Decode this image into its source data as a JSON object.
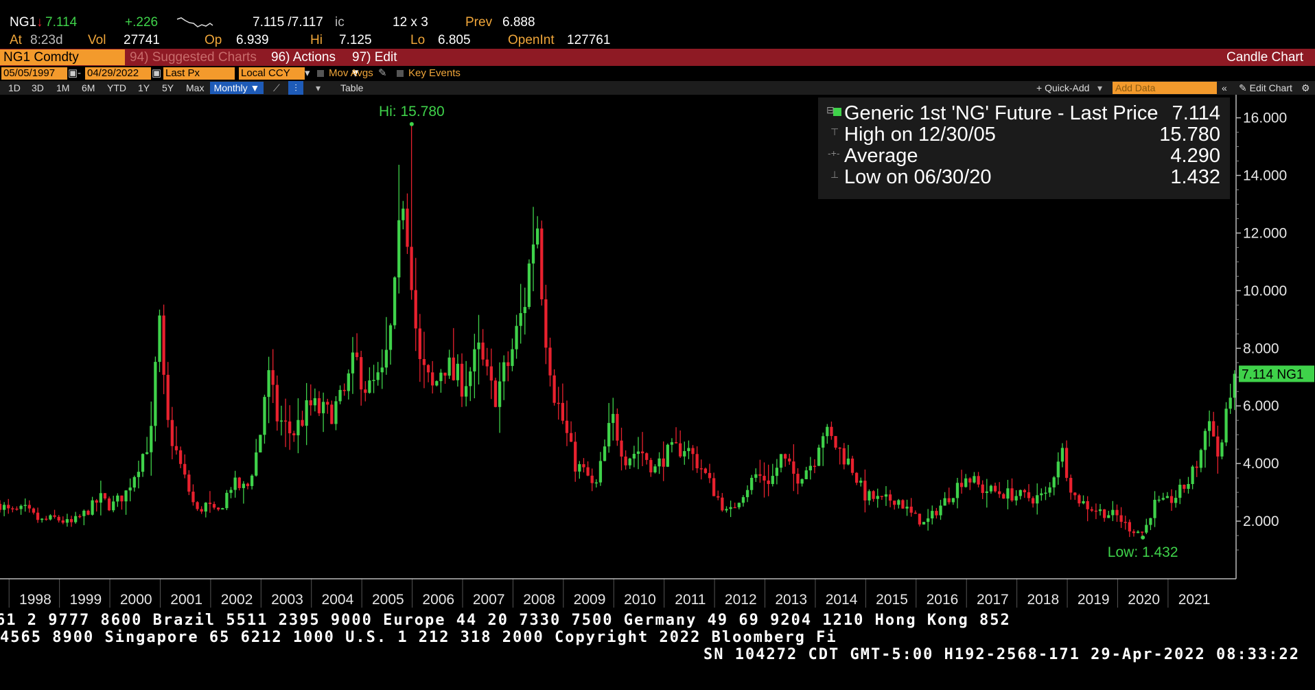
{
  "ticker": {
    "symbol": "NG1",
    "arrow": "↓",
    "last": "7.114",
    "change": "+.226",
    "bidask": "7.115 /7.117",
    "bidask_suffix": "ic",
    "size": "12 x 3",
    "prev_label": "Prev",
    "prev": "6.888",
    "at_label": "At",
    "time": "8:23d",
    "vol_label": "Vol",
    "vol": "27741",
    "op_label": "Op",
    "op": "6.939",
    "hi_label": "Hi",
    "hi": "7.125",
    "lo_label": "Lo",
    "lo": "6.805",
    "oi_label": "OpenInt",
    "oi": "127761"
  },
  "menubar": {
    "security": "NG1 Comdty",
    "suggested": "94) Suggested Charts",
    "actions": "96) Actions",
    "edit": "97) Edit",
    "chart_type": "Candle Chart"
  },
  "settings": {
    "start_date": "05/05/1997",
    "end_date": "04/29/2022",
    "field": "Last Px",
    "currency": "Local CCY",
    "mov_avgs": "Mov Avgs",
    "key_events": "Key Events"
  },
  "periods": {
    "items": [
      "1D",
      "3D",
      "1M",
      "6M",
      "YTD",
      "1Y",
      "5Y",
      "Max"
    ],
    "selected": "Monthly",
    "table": "Table",
    "quick_add": "+ Quick-Add",
    "add_data": "Add Data",
    "edit_chart": "Edit Chart"
  },
  "legend": {
    "title": "Generic 1st 'NG' Future - Last Price",
    "last": "7.114",
    "high_label": "High on 12/30/05",
    "high": "15.780",
    "avg_label": "Average",
    "avg": "4.290",
    "low_label": "Low on 06/30/20",
    "low": "1.432"
  },
  "footer": {
    "line1": "61 2 9777 8600 Brazil 5511 2395 9000 Europe 44 20 7330 7500 Germany 49 69 9204 1210 Hong Kong 852",
    "line2": " 4565 8900        Singapore 65 6212 1000        U.S. 1 212 318 2000        Copyright 2022 Bloomberg Fi",
    "line3": "SN 104272 CDT  GMT-5:00 H192-2568-171 29-Apr-2022 08:33:22"
  },
  "colors": {
    "up": "#3fd24a",
    "down": "#e8212e",
    "accent": "#f39a2c",
    "menubar": "#8e1a24"
  },
  "chart_data": {
    "type": "candlestick",
    "interval": "monthly",
    "y_axis_side": "right",
    "ylim": [
      0,
      16.8
    ],
    "y_ticks": [
      "2.000",
      "4.000",
      "6.000",
      "8.000",
      "10.000",
      "12.000",
      "14.000",
      "16.000"
    ],
    "x_labels": [
      "1998",
      "1999",
      "2000",
      "2001",
      "2002",
      "2003",
      "2004",
      "2005",
      "2006",
      "2007",
      "2008",
      "2009",
      "2010",
      "2011",
      "2012",
      "2013",
      "2014",
      "2015",
      "2016",
      "2017",
      "2018",
      "2019",
      "2020",
      "2021"
    ],
    "x_start": 1997.8,
    "x_end": 2022.33,
    "close_points": [
      [
        1997.8,
        2.6
      ],
      [
        1998.0,
        2.3
      ],
      [
        1998.3,
        2.4
      ],
      [
        1998.6,
        2.0
      ],
      [
        1998.9,
        2.1
      ],
      [
        1999.2,
        1.9
      ],
      [
        1999.5,
        2.3
      ],
      [
        1999.8,
        2.8
      ],
      [
        2000.0,
        2.5
      ],
      [
        2000.3,
        3.0
      ],
      [
        2000.6,
        4.2
      ],
      [
        2000.8,
        5.0
      ],
      [
        2000.95,
        9.0
      ],
      [
        2001.1,
        5.5
      ],
      [
        2001.4,
        3.8
      ],
      [
        2001.7,
        2.3
      ],
      [
        2001.9,
        2.6
      ],
      [
        2002.1,
        2.2
      ],
      [
        2002.4,
        3.3
      ],
      [
        2002.7,
        3.1
      ],
      [
        2002.95,
        4.8
      ],
      [
        2003.1,
        7.2
      ],
      [
        2003.3,
        5.6
      ],
      [
        2003.6,
        5.0
      ],
      [
        2003.95,
        6.0
      ],
      [
        2004.3,
        5.7
      ],
      [
        2004.6,
        6.2
      ],
      [
        2004.85,
        7.6
      ],
      [
        2005.1,
        6.5
      ],
      [
        2005.4,
        7.0
      ],
      [
        2005.6,
        9.0
      ],
      [
        2005.8,
        13.5
      ],
      [
        2005.95,
        11.2
      ],
      [
        2006.1,
        7.5
      ],
      [
        2006.4,
        6.5
      ],
      [
        2006.6,
        7.6
      ],
      [
        2006.8,
        7.0
      ],
      [
        2007.0,
        6.8
      ],
      [
        2007.3,
        7.8
      ],
      [
        2007.6,
        6.3
      ],
      [
        2007.9,
        7.5
      ],
      [
        2008.2,
        9.5
      ],
      [
        2008.45,
        12.8
      ],
      [
        2008.6,
        9.0
      ],
      [
        2008.8,
        6.5
      ],
      [
        2008.95,
        5.6
      ],
      [
        2009.2,
        4.0
      ],
      [
        2009.45,
        3.6
      ],
      [
        2009.6,
        3.0
      ],
      [
        2009.8,
        4.5
      ],
      [
        2009.95,
        5.6
      ],
      [
        2010.2,
        4.2
      ],
      [
        2010.5,
        4.5
      ],
      [
        2010.8,
        3.8
      ],
      [
        2011.0,
        4.3
      ],
      [
        2011.4,
        4.6
      ],
      [
        2011.7,
        3.9
      ],
      [
        2011.95,
        3.1
      ],
      [
        2012.25,
        2.2
      ],
      [
        2012.5,
        2.9
      ],
      [
        2012.8,
        3.6
      ],
      [
        2013.1,
        3.4
      ],
      [
        2013.3,
        4.2
      ],
      [
        2013.6,
        3.5
      ],
      [
        2013.95,
        4.1
      ],
      [
        2014.1,
        5.2
      ],
      [
        2014.4,
        4.6
      ],
      [
        2014.7,
        3.9
      ],
      [
        2014.95,
        2.9
      ],
      [
        2015.3,
        2.7
      ],
      [
        2015.6,
        2.8
      ],
      [
        2015.9,
        2.2
      ],
      [
        2016.15,
        1.9
      ],
      [
        2016.45,
        2.5
      ],
      [
        2016.7,
        3.0
      ],
      [
        2016.95,
        3.6
      ],
      [
        2017.3,
        3.1
      ],
      [
        2017.6,
        3.0
      ],
      [
        2017.95,
        2.9
      ],
      [
        2018.3,
        2.8
      ],
      [
        2018.6,
        2.9
      ],
      [
        2018.85,
        4.6
      ],
      [
        2019.1,
        2.9
      ],
      [
        2019.4,
        2.5
      ],
      [
        2019.7,
        2.3
      ],
      [
        2019.95,
        2.2
      ],
      [
        2020.25,
        1.7
      ],
      [
        2020.5,
        1.6
      ],
      [
        2020.7,
        2.6
      ],
      [
        2020.9,
        2.6
      ],
      [
        2021.1,
        2.8
      ],
      [
        2021.4,
        3.4
      ],
      [
        2021.6,
        4.2
      ],
      [
        2021.8,
        5.8
      ],
      [
        2021.95,
        4.2
      ],
      [
        2022.1,
        5.0
      ],
      [
        2022.25,
        7.2
      ],
      [
        2022.33,
        7.1
      ]
    ],
    "annotations": [
      {
        "text": "Hi: 15.780",
        "x": 2005.97,
        "y": 15.78
      },
      {
        "text": "Low: 1.432",
        "x": 2020.48,
        "y": 1.432
      }
    ],
    "last_label": "7.114 NG1",
    "last_value": 7.114
  }
}
